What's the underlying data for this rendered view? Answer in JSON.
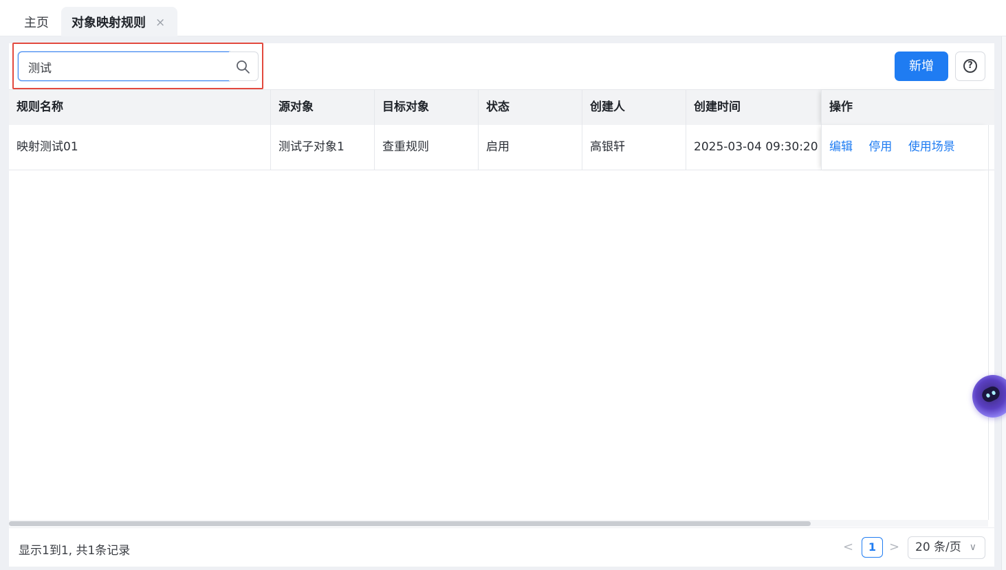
{
  "tabs": {
    "home": "主页",
    "active": "对象映射规则",
    "close_glyph": "×"
  },
  "search": {
    "value": "测试",
    "icon": "search-icon"
  },
  "toolbar": {
    "add_label": "新增",
    "help_icon": "help-circle-icon",
    "help_glyph": "?"
  },
  "table": {
    "headers": [
      "规则名称",
      "源对象",
      "目标对象",
      "状态",
      "创建人",
      "创建时间",
      "操作"
    ],
    "rows": [
      {
        "name": "映射测试01",
        "source": "测试子对象1",
        "target": "查重规则",
        "status": "启用",
        "creator": "高银轩",
        "created_at": "2025-03-04 09:30:20",
        "actions": [
          "编辑",
          "停用",
          "使用场景"
        ]
      }
    ]
  },
  "pagination": {
    "summary": "显示1到1, 共1条记录",
    "prev": "<",
    "current": "1",
    "next": ">",
    "page_size": "20 条/页"
  },
  "colors": {
    "primary": "#1f7cf2",
    "highlight_box": "#e2483d"
  }
}
